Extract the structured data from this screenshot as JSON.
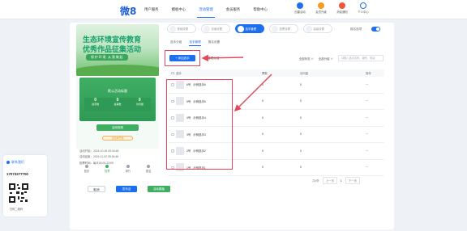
{
  "header": {
    "logo_text": "微8",
    "nav": [
      "用户服务",
      "模板中心",
      "活动管理",
      "会员服务",
      "帮助中心"
    ],
    "nav_active_index": 2,
    "actions": [
      {
        "label": "创建活动",
        "icon": "create-icon",
        "color": "#1d6ff2"
      },
      {
        "label": "会员升级",
        "icon": "crown-icon",
        "color": "#f59a23"
      },
      {
        "label": "消息通知",
        "icon": "bell-icon",
        "color": "#f0553c"
      },
      {
        "label": "个人中心",
        "icon": "user-icon",
        "color": "#1d6ff2"
      }
    ]
  },
  "preview": {
    "banner_line1": "生态环境宣传教育",
    "banner_line2": "优秀作品征集活动",
    "banner_tagline": "保护环境 从我做起",
    "event_name": "默认活动标题",
    "stats": [
      {
        "value": "0",
        "label": "选手数"
      },
      {
        "value": "0",
        "label": "总票数"
      },
      {
        "value": "0",
        "label": "访问量"
      }
    ],
    "rules_button": "活动规则",
    "start_pill": "活动未开始",
    "times": [
      "活动开始：2024-10-26 09:34:46",
      "活动结束：2024-11-02 09:34:46",
      "投票时间：每天00:00-23:59"
    ],
    "bottom_tabs": [
      "首页",
      "投票",
      "排行",
      "报名"
    ],
    "bottom_tab_active": 1
  },
  "left_buttons": {
    "cancel": "取消",
    "publish": "发布活动",
    "save": "活动模板"
  },
  "steps": [
    "基础设置",
    "页面设置",
    "选手管理",
    "投票设置",
    "高级设置"
  ],
  "step_active": 2,
  "switch_label": "报名选项",
  "subtabs": [
    "选手分组",
    "选手管理",
    "报名设置"
  ],
  "subtab_active": 1,
  "add_button": "+ 添加选手",
  "manage_group": "管理分组",
  "filters": [
    "全部状态 ∨",
    "全部分组 ∨"
  ],
  "search_placeholder": "请输入选手名称、编号、电话",
  "table": {
    "headers": [
      "选手",
      "票数",
      "访问量",
      "操作"
    ],
    "rows": [
      {
        "no": "6号",
        "name": "示例选手6",
        "votes": "0",
        "visits": "0",
        "op": "···"
      },
      {
        "no": "5号",
        "name": "示例选手5",
        "votes": "0",
        "visits": "0",
        "op": "···"
      },
      {
        "no": "4号",
        "name": "示例选手4",
        "votes": "0",
        "visits": "0",
        "op": "···"
      },
      {
        "no": "3号",
        "name": "示例选手3",
        "votes": "0",
        "visits": "0",
        "op": "···"
      },
      {
        "no": "2号",
        "name": "示例选手2",
        "votes": "0",
        "visits": "0",
        "op": "···"
      },
      {
        "no": "1号",
        "name": "示例选手1",
        "votes": "0",
        "visits": "0",
        "op": "···"
      }
    ]
  },
  "pager": {
    "total": "共6条",
    "prev": "上一页",
    "page": "1",
    "next": "下一页"
  },
  "contact": {
    "title": "联系我们",
    "phone": "17073277700",
    "qr_label": "扫码二维码"
  },
  "colors": {
    "primary": "#1d6ff2",
    "green": "#3fae63",
    "highlight": "#e8455a"
  }
}
